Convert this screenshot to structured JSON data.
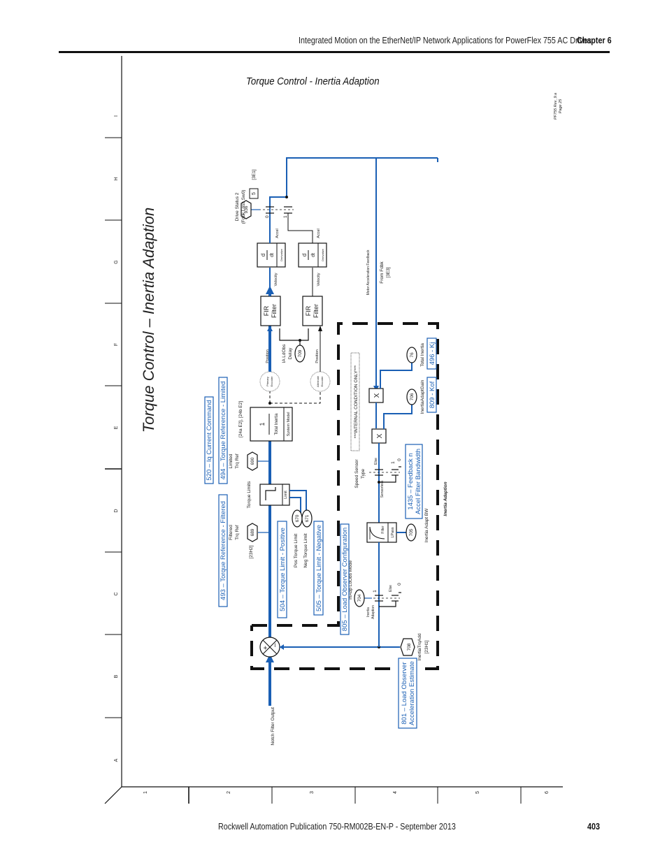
{
  "page_header": {
    "title": "Integrated Motion on the EtherNet/IP Network Applications for PowerFlex 755 AC Drives",
    "chapter": "Chapter 6"
  },
  "subtitle": "Torque Control - Inertia Adaption",
  "diagram": {
    "title": "Torque Control – Inertia Adaption",
    "revision": "PF755 Rev_9.a",
    "page_ref": "Page 25",
    "grid_rows": [
      "A",
      "B",
      "C",
      "D",
      "E",
      "F",
      "G",
      "H",
      "I"
    ],
    "grid_cols": [
      "1",
      "2",
      "3",
      "4",
      "5",
      "6"
    ],
    "inputs": {
      "notch_filter": "Notch Filter Output"
    },
    "parameter_links": {
      "p520": "520 – Iq Current Command",
      "p494": "494 – Torque Reference - Limited",
      "p493": "493 – Torque Reference - Filtered",
      "p504": "504 – Torque Limit - Positive",
      "p505": "505 – Torque Limit - Negative",
      "p805": "805 – Load Observer Configuration",
      "p801_l1": "801 – Load Observer",
      "p801_l2": "Acceleration Estimate",
      "p1435_l1": "1435 – Feedback n",
      "p1435_l2": "Accel Filter Bandwidth",
      "p809": "809 - Kof",
      "p496": "496 - Kj"
    },
    "params": {
      "p689": {
        "num": "689",
        "label_1": "Filtered",
        "label_2": "Trq Ref",
        "ref": "[23H2]"
      },
      "p690": {
        "num": "690",
        "label_1": "Limited",
        "label_2": "Trq Ref",
        "ref": "[24a E2], [24b E2]"
      },
      "p670": {
        "num": "670",
        "label": "Pos Torque Limit"
      },
      "p671": {
        "num": "671",
        "label": "Neg Torque Limit"
      },
      "p709": {
        "num": "709",
        "label_1": "IA LdObs",
        "label_2": "Delay"
      },
      "p936": {
        "num": "936",
        "bit": "5",
        "label_1": "Drive Status 2",
        "label_2": "(Fdbk Loss Sw0)",
        "ref": "[3E1]"
      },
      "p704": {
        "num": "704",
        "label": "InAdp LdObs Mode",
        "option_1": "Inertia",
        "option_2": "Adaption",
        "else": "Else",
        "sw_1": "1",
        "sw_0": "0"
      },
      "p705": {
        "num": "705",
        "label": "Inertia Adapt BW"
      },
      "p706": {
        "num": "706",
        "label": "InertiaAdaptGain"
      },
      "p76": {
        "num": "76",
        "label": "Total Inertia"
      },
      "p708": {
        "num": "708",
        "label": "InertiaTrqAdd",
        "ref": "[23H1]"
      }
    },
    "blocks": {
      "torque_limits": "Torque Limits",
      "limit": "Limit",
      "system_model_num": "1",
      "system_model_den": "Total Inertia",
      "system_model": "System Model",
      "fir": "FIR Filter",
      "fir_l1": "FIR",
      "fir_l2": "Filter",
      "deriv_d": "d",
      "deriv_dt": "dt",
      "derivative": "Derivative",
      "lpass": "LPass",
      "filter": "Filter",
      "multiply": "X",
      "primary_encoder_1": "Primary",
      "primary_encoder_2": "Encoder",
      "alternate_encoder_1": "Alternate",
      "alternate_encoder_2": "Encoder"
    },
    "signals": {
      "position": "Position",
      "velocity": "Velocity",
      "accel": "Accel",
      "motor_accel_fb": "Motor Acceleration Feedback",
      "from_fdbk": "From Fdbk",
      "from_fdbk_ref": "[3E3]",
      "speed_sensor_1": "Speed Sensor",
      "speed_sensor_2": "Type",
      "sensorless": "Sensorless",
      "else": "Else",
      "sw_0": "0",
      "sw_1": "1",
      "internal_only": "***INTERNAL CONDITION ONLY***",
      "inertia_adaption_region": "Inertia Adaption",
      "sum_plus": "+",
      "sum_minus": "–"
    }
  },
  "footer": {
    "publication": "Rockwell Automation Publication 750-RM002B-EN-P - September 2013",
    "page": "403"
  }
}
